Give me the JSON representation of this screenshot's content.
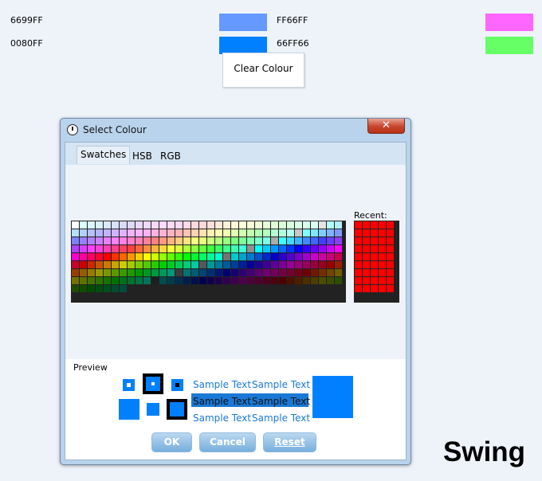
{
  "rows": [
    {
      "left_hex": "6699FF",
      "left_color": "#6699FF",
      "right_hex": "FF66FF",
      "right_color": "#FF66FF"
    },
    {
      "left_hex": "0080FF",
      "left_color": "#0080FF",
      "right_hex": "66FF66",
      "right_color": "#66FF66"
    }
  ],
  "popup_menu": {
    "clear_label": "Clear Colour"
  },
  "dialog": {
    "title": "Select Colour",
    "close_glyph": "✕",
    "tabs": [
      "Swatches",
      "HSB",
      "RGB"
    ],
    "selected_tab": "Swatches",
    "recent_label": "Recent:",
    "recent_color": "#FF0000",
    "preview_label": "Preview",
    "preview_color": "#0080FF",
    "sample_text": "Sample Text",
    "buttons": {
      "ok": "OK",
      "cancel": "Cancel",
      "reset": "Reset"
    }
  },
  "brand": "Swing"
}
